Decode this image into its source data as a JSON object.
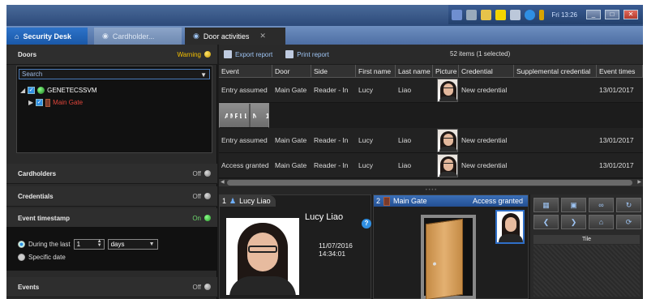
{
  "taskbar": {
    "clock": "Fri 13:26",
    "window_buttons": [
      "_",
      "□",
      "✕"
    ]
  },
  "tabs": {
    "home": "Security Desk",
    "cardholder": "Cardholder...",
    "door": "Door activities"
  },
  "left": {
    "doors": {
      "title": "Doors",
      "state": "Warning"
    },
    "search_placeholder": "Search",
    "tree": {
      "server": "GENETECSSVM",
      "door": "Main Gate"
    },
    "cardholders": {
      "title": "Cardholders",
      "state": "Off"
    },
    "credentials": {
      "title": "Credentials",
      "state": "Off"
    },
    "event_timestamp": {
      "title": "Event timestamp",
      "state": "On",
      "during_label": "During the last",
      "during_value": "1",
      "unit": "days",
      "specific_label": "Specific date"
    },
    "events": {
      "title": "Events",
      "state": "Off"
    }
  },
  "toolbar": {
    "export": "Export report",
    "print": "Print report",
    "count": "52 items (1 selected)"
  },
  "table": {
    "headers": [
      "Event",
      "Door",
      "Side",
      "First name",
      "Last name",
      "Picture",
      "Credential",
      "Supplemental credential",
      "Event times"
    ],
    "rows": [
      [
        "Entry assumed",
        "Main Gate",
        "Reader - In",
        "Lucy",
        "Liao",
        "",
        "New credential",
        "",
        "13/01/2017"
      ],
      [
        "Access granted",
        "Main Gate",
        "Reader - In",
        "Lucy",
        "Liao",
        "",
        "New credential",
        "",
        "13/01/20"
      ],
      [
        "Entry assumed",
        "Main Gate",
        "Reader - In",
        "Lucy",
        "Liao",
        "",
        "New credential",
        "",
        "13/01/2017"
      ],
      [
        "Access granted",
        "Main Gate",
        "Reader - In",
        "Lucy",
        "Liao",
        "",
        "New credential",
        "",
        "13/01/2017"
      ]
    ]
  },
  "tile1": {
    "num": "1",
    "name": "Lucy Liao",
    "person": "Lucy Liao",
    "date": "11/07/2016",
    "time": "14:34:01"
  },
  "tile2": {
    "num": "2",
    "name": "Main Gate",
    "status": "Access granted"
  },
  "controls": {
    "tile_label": "Tile"
  }
}
